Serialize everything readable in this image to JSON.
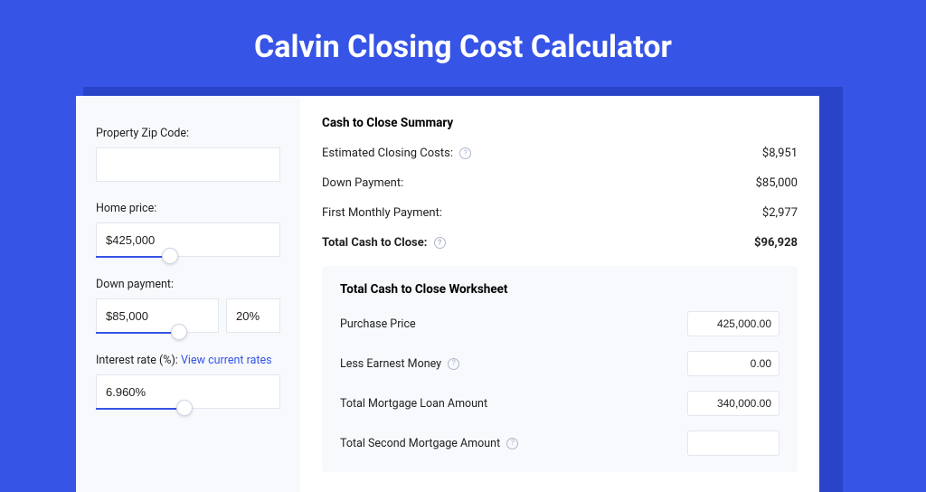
{
  "title": "Calvin Closing Cost Calculator",
  "form": {
    "zip_label": "Property Zip Code:",
    "zip_value": "",
    "home_price_label": "Home price:",
    "home_price_value": "$425,000",
    "down_payment_label": "Down payment:",
    "down_payment_value": "$85,000",
    "down_payment_pct": "20%",
    "interest_label": "Interest rate (%):",
    "interest_link_text": "View current rates",
    "interest_value": "6.960%"
  },
  "summary": {
    "title": "Cash to Close Summary",
    "closing_costs_label": "Estimated Closing Costs:",
    "closing_costs_value": "$8,951",
    "down_payment_label": "Down Payment:",
    "down_payment_value": "$85,000",
    "monthly_label": "First Monthly Payment:",
    "monthly_value": "$2,977",
    "total_label": "Total Cash to Close:",
    "total_value": "$96,928"
  },
  "worksheet": {
    "title": "Total Cash to Close Worksheet",
    "purchase_label": "Purchase Price",
    "purchase_value": "425,000.00",
    "earnest_label": "Less Earnest Money",
    "earnest_value": "0.00",
    "loan_label": "Total Mortgage Loan Amount",
    "loan_value": "340,000.00",
    "second_label": "Total Second Mortgage Amount"
  }
}
